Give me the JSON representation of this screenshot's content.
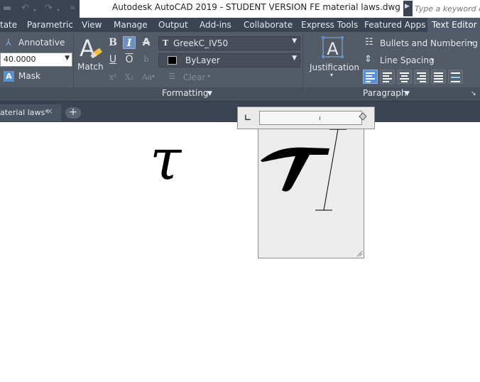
{
  "window": {
    "title": "Autodesk AutoCAD 2019 - STUDENT VERSION    FE material laws.dwg"
  },
  "search": {
    "placeholder": "Type a keyword or"
  },
  "ribbon_tabs": [
    {
      "label": "tate"
    },
    {
      "label": "Parametric"
    },
    {
      "label": "View"
    },
    {
      "label": "Manage"
    },
    {
      "label": "Output"
    },
    {
      "label": "Add-ins"
    },
    {
      "label": "Collaborate"
    },
    {
      "label": "Express Tools"
    },
    {
      "label": "Featured Apps"
    },
    {
      "label": "Text Editor",
      "active": true
    }
  ],
  "style_panel": {
    "annotative_label": "Annotative",
    "text_height": "40.0000",
    "mask_label": "Mask"
  },
  "formatting_panel": {
    "match_label": "Match",
    "font_name": "GreekC_IV50",
    "color_name": "ByLayer",
    "clear_label": "Clear",
    "footer_label": "Formatting",
    "buttons": [
      "B",
      "I",
      "A",
      "U",
      "O",
      "b",
      "x²",
      "X₂",
      "Aa"
    ]
  },
  "paragraph_panel": {
    "justification_label": "Justification",
    "bullets_label": "Bullets and Numbering",
    "line_spacing_label": "Line Spacing",
    "footer_label": "Paragraph"
  },
  "file_tabs": {
    "active_tab": "aterial laws*"
  },
  "drawing": {
    "tau_symbol": "τ"
  },
  "colors": {
    "ribbon_bg": "#535b67",
    "tab_bar_bg": "#3b4453",
    "active_accent": "#5c8fd0",
    "canvas_bg": "#ffffff"
  }
}
